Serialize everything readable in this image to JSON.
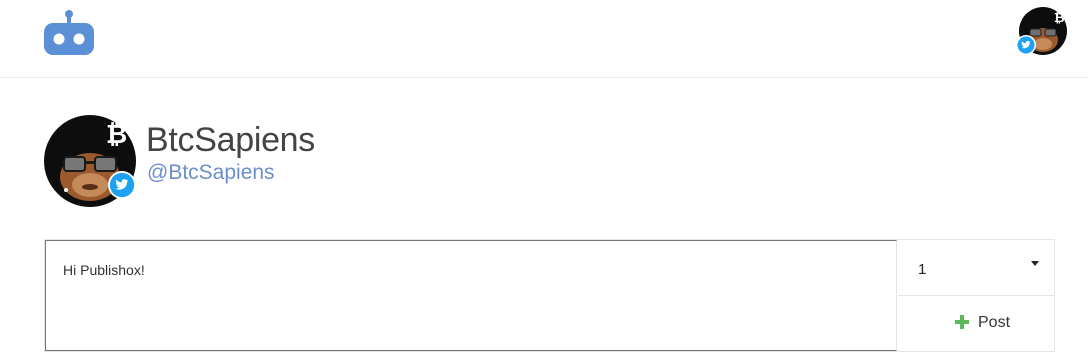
{
  "header": {
    "logo_icon": "robot-logo-icon",
    "brand_color": "#5b8fd6",
    "avatar_icon": "monkey-avatar-icon"
  },
  "profile": {
    "name": "BtcSapiens",
    "handle": "@BtcSapiens",
    "platform_badge_icon": "twitter-icon",
    "badge_color": "#1da1f2"
  },
  "composer": {
    "text": "Hi Publishox!",
    "count_value": "1",
    "post_label": "Post",
    "post_icon": "plus-icon",
    "post_icon_color": "#5cb85c"
  }
}
